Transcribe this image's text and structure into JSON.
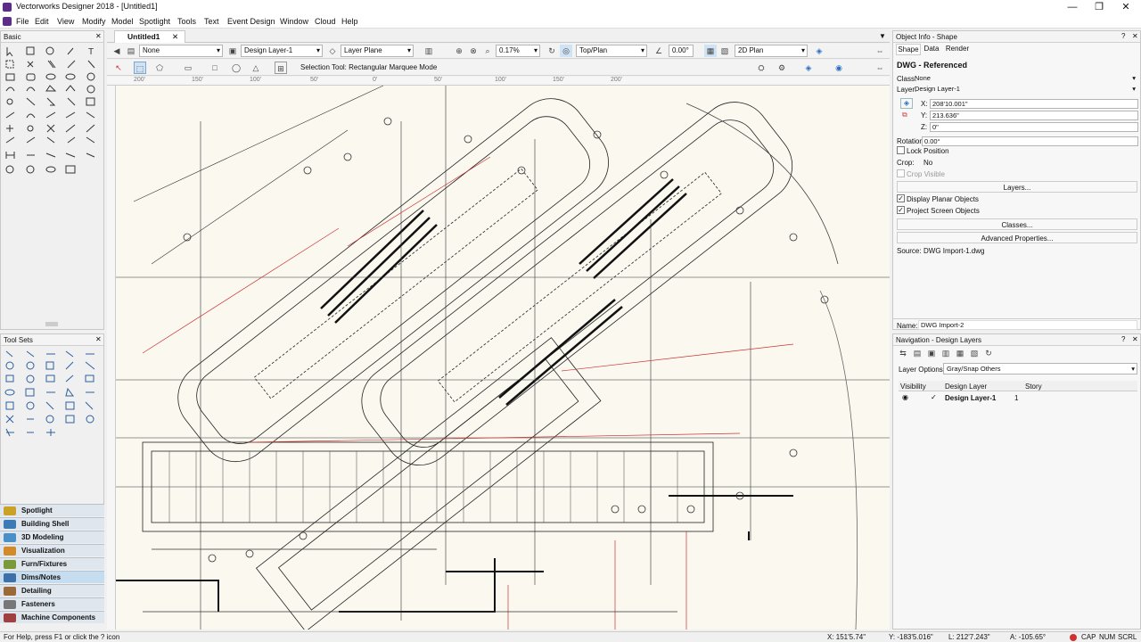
{
  "window": {
    "title": "Vectorworks Designer 2018 - [Untitled1]",
    "min": "—",
    "restore": "❐",
    "close": "✕"
  },
  "menu": [
    "File",
    "Edit",
    "View",
    "Modify",
    "Model",
    "Spotlight",
    "Tools",
    "Text",
    "Event Design",
    "Window",
    "Cloud",
    "Help"
  ],
  "basic_palette": {
    "title": "Basic"
  },
  "tool_sets": {
    "title": "Tool Sets"
  },
  "tool_set_list": [
    {
      "label": "Spotlight",
      "color": "#c9a227"
    },
    {
      "label": "Building Shell",
      "color": "#3d7ab8"
    },
    {
      "label": "3D Modeling",
      "color": "#4a90c8"
    },
    {
      "label": "Visualization",
      "color": "#d58a2a"
    },
    {
      "label": "Furn/Fixtures",
      "color": "#7a9a3a"
    },
    {
      "label": "Dims/Notes",
      "color": "#3d6fa8",
      "active": true
    },
    {
      "label": "Detailing",
      "color": "#9a6a3a"
    },
    {
      "label": "Fasteners",
      "color": "#777777"
    },
    {
      "label": "Machine Components",
      "color": "#a04040"
    }
  ],
  "doc_tab": {
    "label": "Untitled1",
    "close": "✕"
  },
  "view_bar": {
    "class_value": "None",
    "layer_value": "Design Layer-1",
    "plane_value": "Layer Plane",
    "zoom_value": "0.17%",
    "view_value": "Top/Plan",
    "angle_value": "0.00°",
    "render_value": "2D Plan"
  },
  "tool_mode": {
    "label": "Selection Tool: Rectangular Marquee Mode"
  },
  "rulers": {
    "h_ticks": [
      "200'",
      "150'",
      "100'",
      "50'",
      "0'",
      "50'",
      "100'",
      "150'",
      "200'"
    ]
  },
  "object_info": {
    "title": "Object Info - Shape",
    "tabs": [
      "Shape",
      "Data",
      "Render"
    ],
    "type_label": "DWG - Referenced",
    "class_label": "Class:",
    "class_value": "None",
    "layer_label": "Layer:",
    "layer_value": "Design Layer-1",
    "x_label": "X:",
    "x_value": "208'10.001\"",
    "y_label": "Y:",
    "y_value": "213.636\"",
    "z_label": "Z:",
    "z_value": "0\"",
    "rotation_label": "Rotation:",
    "rotation_value": "0.00°",
    "lock_position": "Lock Position",
    "crop_label": "Crop:",
    "crop_value": "No",
    "crop_visible": "Crop Visible",
    "layers_button": "Layers...",
    "display_planar": "Display Planar Objects",
    "project_screen": "Project Screen Objects",
    "classes_button": "Classes...",
    "advanced_button": "Advanced Properties...",
    "source_label": "Source:",
    "source_value": "DWG Import-1.dwg",
    "name_label": "Name:",
    "name_value": "DWG Import-2"
  },
  "navigation": {
    "title": "Navigation - Design Layers",
    "layer_options_label": "Layer Options:",
    "layer_options_value": "Gray/Snap Others",
    "columns": [
      "Visibility",
      "Design Layer",
      "Story"
    ],
    "rows": [
      {
        "layer": "Design Layer-1",
        "story": "1"
      }
    ]
  },
  "status": {
    "help": "For Help, press F1 or click the ? icon",
    "x": "X: 151'5.74\"",
    "y": "Y: -183'5.016\"",
    "l": "L: 212'7.243\"",
    "a": "A: -105.65°",
    "caps": "CAP",
    "num": "NUM",
    "scrl": "SCRL"
  }
}
